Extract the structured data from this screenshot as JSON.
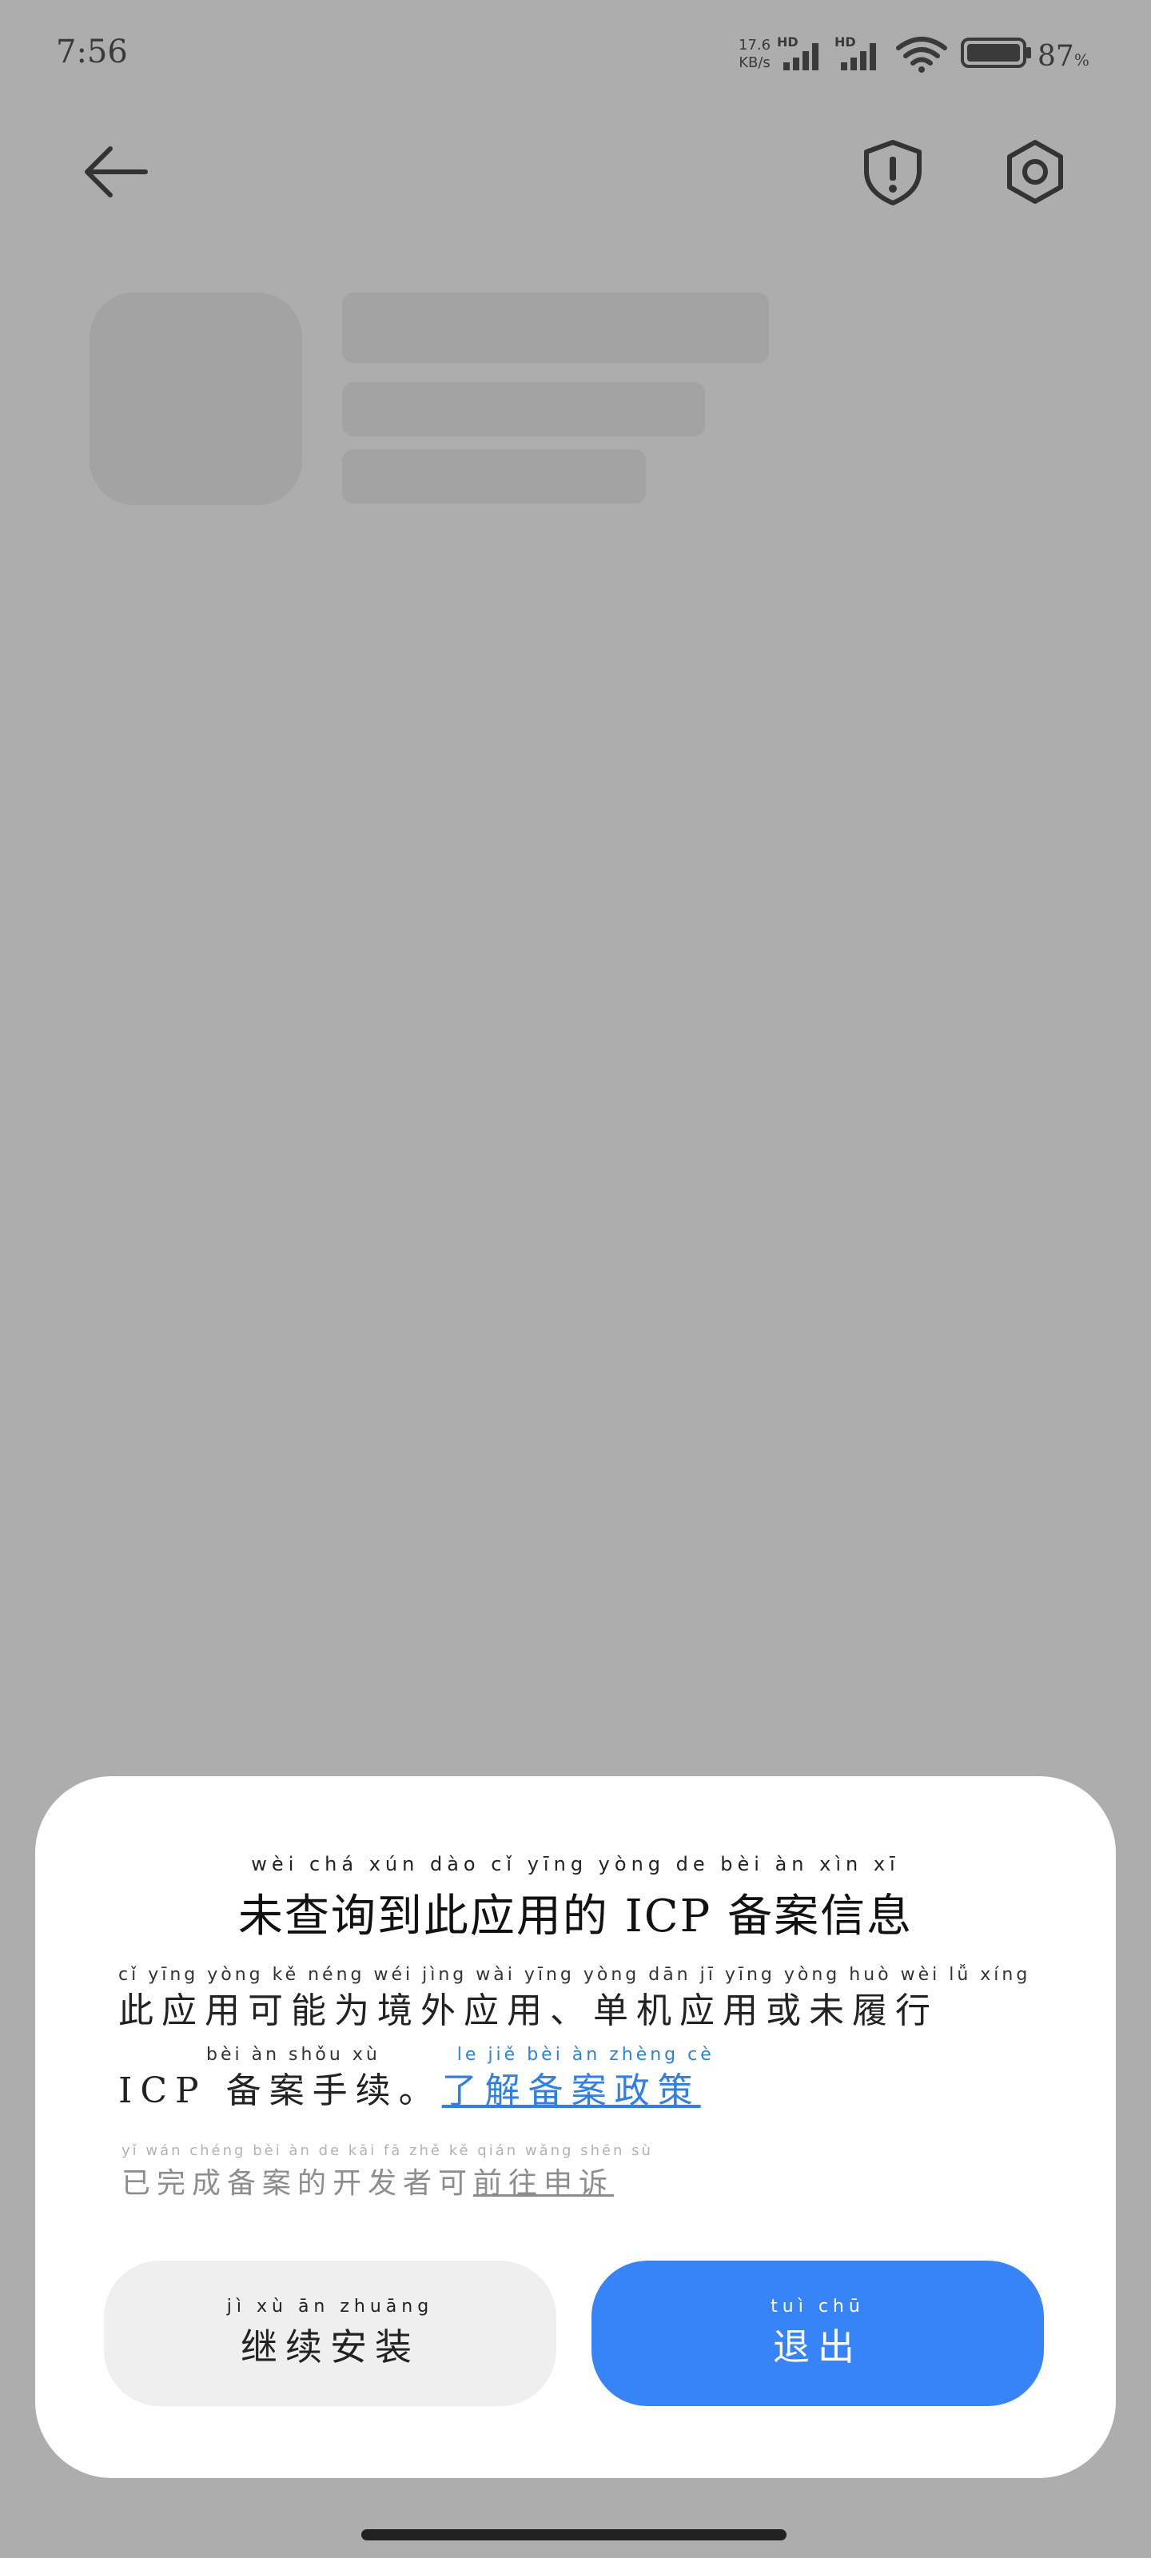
{
  "status_bar": {
    "time": "7:56",
    "net_speed_value": "17.6",
    "net_speed_unit": "KB/s",
    "network_1": "HD",
    "network_2": "HD",
    "battery_percent": "87",
    "battery_unit": "%"
  },
  "dialog": {
    "title_pinyin": "wèi chá xún dào cǐ yīng yòng de  bèi àn xìn xī",
    "title": "未查询到此应用的 ICP 备案信息",
    "body_pinyin_line1": "cǐ yīng yòng kě néng wéi jìng wài yīng yòng  dān jī yīng yòng huò wèi lǚ xíng",
    "body_line1": "此应用可能为境外应用、单机应用或未履行",
    "body_pinyin_line2": "bèi àn shǒu xù",
    "body_pinyin_link": "le jiě bèi àn zhèng cè",
    "body_line2": "ICP 备案手续。",
    "policy_link": "了解备案政策",
    "appeal_pinyin": "yǐ wán chéng bèi àn de kāi fā zhě kě qián wǎng shēn sù",
    "appeal_text": "已完成备案的开发者可",
    "appeal_link": "前往申诉",
    "continue_pinyin": "jì xù ān zhuāng",
    "continue_label": "继续安装",
    "exit_pinyin": "tuì chū",
    "exit_label": "退出"
  },
  "colors": {
    "overlay": "#adadad",
    "link": "#2f7fe6",
    "primary_button": "#3784f8",
    "secondary_button": "#efefef"
  },
  "icons": [
    "signal-icon",
    "wifi-icon",
    "battery-icon",
    "back-arrow-icon",
    "shield-alert-icon",
    "gear-icon"
  ]
}
